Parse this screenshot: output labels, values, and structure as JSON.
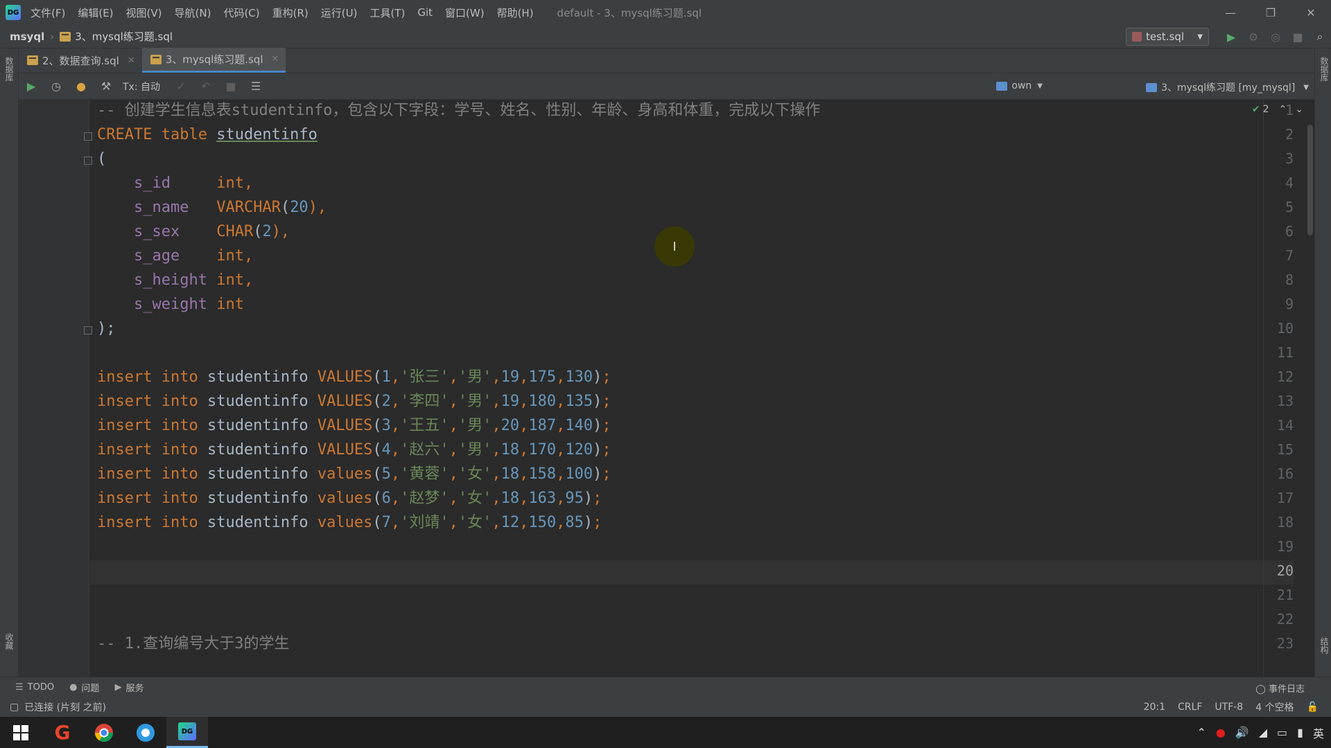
{
  "titlebar": {
    "menu": [
      "文件(F)",
      "编辑(E)",
      "视图(V)",
      "导航(N)",
      "代码(C)",
      "重构(R)",
      "运行(U)",
      "工具(T)",
      "Git",
      "窗口(W)",
      "帮助(H)"
    ],
    "window_title": "default - 3、mysql练习题.sql"
  },
  "navbar": {
    "project": "msyql",
    "file": "3、mysql练习题.sql",
    "run_config": "test.sql"
  },
  "left_strip": {
    "top_label": "数据库",
    "bottom_label": "收藏"
  },
  "right_strip": {
    "top_label": "数据库",
    "bottom_label": "结构"
  },
  "tabs": [
    {
      "label": "2、数据查询.sql",
      "active": false
    },
    {
      "label": "3、mysql练习题.sql",
      "active": true
    }
  ],
  "editor_toolbar": {
    "tx_mode": "Tx: 自动",
    "schema": "own",
    "console": "3、mysql练习题 [my_mysql]"
  },
  "editor": {
    "inspection_count": "2",
    "current_line": 20,
    "line_numbers": [
      "1",
      "2",
      "3",
      "4",
      "5",
      "6",
      "7",
      "8",
      "9",
      "10",
      "11",
      "12",
      "13",
      "14",
      "15",
      "16",
      "17",
      "18",
      "19",
      "20",
      "21",
      "22",
      "23"
    ],
    "lines": [
      {
        "n": 1,
        "comment": "-- 创建学生信息表studentinfo，包含以下字段：学号、姓名、性别、年龄、身高和体重，完成以下操作"
      },
      {
        "n": 2,
        "kw": "CREATE table",
        "name": "studentinfo"
      },
      {
        "n": 3,
        "text": "("
      },
      {
        "n": 4,
        "col": "s_id",
        "type": "int",
        "rest": ","
      },
      {
        "n": 5,
        "col": "s_name",
        "type": "VARCHAR",
        "arg": "20",
        "rest": "),"
      },
      {
        "n": 6,
        "col": "s_sex",
        "type": "CHAR",
        "arg": "2",
        "rest": "),"
      },
      {
        "n": 7,
        "col": "s_age",
        "type": "int",
        "rest": ","
      },
      {
        "n": 8,
        "col": "s_height",
        "type": "int",
        "rest": ","
      },
      {
        "n": 9,
        "col": "s_weight",
        "type": "int",
        "rest": ""
      },
      {
        "n": 10,
        "text": ");"
      },
      {
        "n": 12,
        "kw": "insert into",
        "table": "studentinfo",
        "fn": "VALUES",
        "id": "1",
        "name": "'张三'",
        "sex": "'男'",
        "age": "19",
        "h": "175",
        "w": "130"
      },
      {
        "n": 13,
        "kw": "insert into",
        "table": "studentinfo",
        "fn": "VALUES",
        "id": "2",
        "name": "'李四'",
        "sex": "'男'",
        "age": "19",
        "h": "180",
        "w": "135"
      },
      {
        "n": 14,
        "kw": "insert into",
        "table": "studentinfo",
        "fn": "VALUES",
        "id": "3",
        "name": "'王五'",
        "sex": "'男'",
        "age": "20",
        "h": "187",
        "w": "140"
      },
      {
        "n": 15,
        "kw": "insert into",
        "table": "studentinfo",
        "fn": "VALUES",
        "id": "4",
        "name": "'赵六'",
        "sex": "'男'",
        "age": "18",
        "h": "170",
        "w": "120"
      },
      {
        "n": 16,
        "kw": "insert into",
        "table": "studentinfo",
        "fn": "values",
        "id": "5",
        "name": "'黄蓉'",
        "sex": "'女'",
        "age": "18",
        "h": "158",
        "w": "100"
      },
      {
        "n": 17,
        "kw": "insert into",
        "table": "studentinfo",
        "fn": "values",
        "id": "6",
        "name": "'赵梦'",
        "sex": "'女'",
        "age": "18",
        "h": "163",
        "w": "95"
      },
      {
        "n": 18,
        "kw": "insert into",
        "table": "studentinfo",
        "fn": "values",
        "id": "7",
        "name": "'刘靖'",
        "sex": "'女'",
        "age": "12",
        "h": "150",
        "w": "85"
      },
      {
        "n": 23,
        "comment": "-- 1.查询编号大于3的学生"
      }
    ]
  },
  "bottom_tools": {
    "todo": "TODO",
    "problems": "问题",
    "services": "服务",
    "event_log": "事件日志"
  },
  "statusbar": {
    "connection": "已连接 (片刻 之前)",
    "position": "20:1",
    "line_sep": "CRLF",
    "encoding": "UTF-8",
    "indent": "4 个空格"
  },
  "taskbar": {
    "ime": "英"
  },
  "colors": {
    "keyword": "#cc7832",
    "number": "#6897bb",
    "string": "#6a8759",
    "comment": "#808080",
    "text": "#a9b7c6"
  }
}
